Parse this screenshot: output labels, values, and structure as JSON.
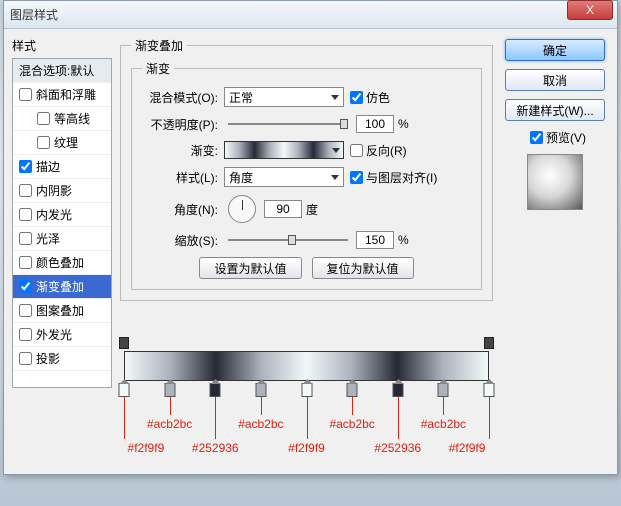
{
  "window": {
    "title": "图层样式",
    "close": "X"
  },
  "left": {
    "heading": "样式",
    "blend_header": "混合选项:默认",
    "items": [
      {
        "label": "斜面和浮雕",
        "checked": false
      },
      {
        "label": "等高线",
        "checked": false,
        "indent": true
      },
      {
        "label": "纹理",
        "checked": false,
        "indent": true
      },
      {
        "label": "描边",
        "checked": true
      },
      {
        "label": "内阴影",
        "checked": false
      },
      {
        "label": "内发光",
        "checked": false
      },
      {
        "label": "光泽",
        "checked": false
      },
      {
        "label": "颜色叠加",
        "checked": false
      },
      {
        "label": "渐变叠加",
        "checked": true,
        "selected": true
      },
      {
        "label": "图案叠加",
        "checked": false
      },
      {
        "label": "外发光",
        "checked": false
      },
      {
        "label": "投影",
        "checked": false
      }
    ]
  },
  "main": {
    "group_title": "渐变叠加",
    "subgroup_title": "渐变",
    "blend_mode_label": "混合模式(O):",
    "blend_mode_value": "正常",
    "dither_label": "仿色",
    "dither_checked": true,
    "opacity_label": "不透明度(P):",
    "opacity_value": "100",
    "percent": "%",
    "gradient_label": "渐变:",
    "reverse_label": "反向(R)",
    "reverse_checked": false,
    "style_label": "样式(L):",
    "style_value": "角度",
    "align_label": "与图层对齐(I)",
    "align_checked": true,
    "angle_label": "角度(N):",
    "angle_value": "90",
    "angle_unit": "度",
    "scale_label": "缩放(S):",
    "scale_value": "150",
    "btn_default": "设置为默认值",
    "btn_reset": "复位为默认值"
  },
  "right": {
    "ok": "确定",
    "cancel": "取消",
    "new_style": "新建样式(W)...",
    "preview_label": "预览(V)",
    "preview_checked": true
  },
  "gradient_stops": {
    "opacity": [
      0,
      100
    ],
    "color": [
      {
        "pos": 0,
        "hex": "#f2f9f9"
      },
      {
        "pos": 12.5,
        "hex": "#acb2bc"
      },
      {
        "pos": 25,
        "hex": "#252936"
      },
      {
        "pos": 37.5,
        "hex": "#acb2bc"
      },
      {
        "pos": 50,
        "hex": "#f2f9f9"
      },
      {
        "pos": 62.5,
        "hex": "#acb2bc"
      },
      {
        "pos": 75,
        "hex": "#252936"
      },
      {
        "pos": 87.5,
        "hex": "#acb2bc"
      },
      {
        "pos": 100,
        "hex": "#f2f9f9"
      }
    ]
  },
  "annotations": {
    "upper": [
      "#acb2bc",
      "#acb2bc",
      "#acb2bc",
      "#acb2bc"
    ],
    "lower": [
      "#f2f9f9",
      "#252936",
      "#f2f9f9",
      "#252936",
      "#f2f9f9"
    ]
  }
}
